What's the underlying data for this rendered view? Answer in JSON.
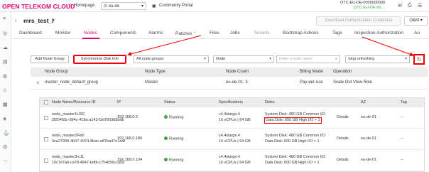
{
  "topbar": {
    "brand": "OPEN TELEKOM CLOUD",
    "homepage": "Homepage",
    "region": "eu-de",
    "community": "Community Portal",
    "account_id": "OTC-EU-DE-0000000000",
    "account_name": "OTC-EU-DE-00…"
  },
  "header": {
    "cluster_name": "mrs_test_l",
    "download_btn": "Download Authentication Credential",
    "om_btn": "O&M"
  },
  "tabs": [
    "Dashboard",
    "Monitor",
    "Nodes",
    "Components",
    "Alarms",
    "Patches",
    "Files",
    "Jobs",
    "Tenants",
    "Bootstrap Actions",
    "Tags",
    "Inspection Authorization",
    "Au"
  ],
  "toolbar": {
    "add_node_group": "Add Node Group",
    "sync_disk": "Synchronize Disk Info",
    "node_groups_filter": "All node groups",
    "node_filter": "Node",
    "search_placeholder": "Enter a node name",
    "refresh_mode": "Stop refreshing"
  },
  "group_table": {
    "headers": [
      "Node Group",
      "Node Type",
      "Node Count",
      "Billing Mode",
      "Operation"
    ],
    "row": {
      "name": "master_node_default_group",
      "type": "Master",
      "count": "eu-de-01: 3",
      "billing": "Pay-per-use",
      "scale_out": "Scale Out",
      "view_role": "View Role"
    }
  },
  "node_table": {
    "headers": [
      "Node Name/Resource ID",
      "IP",
      "Status",
      "Specifications",
      "Disks",
      "",
      "AZ",
      "Tag"
    ],
    "rows": [
      {
        "name": "node_master1tJSC",
        "rid": "2f20460c-994c-419a-a143-f3d790366bdb",
        "ip": "192.168.0.5",
        "status": "Running",
        "spec1": "c4.4xlarge.4",
        "spec2": "16 vCPUs | 64 GB",
        "disk1": "System Disk: 480 GB Common I/O",
        "disk2": "Data Disk: 600 GB High I/O × 1",
        "details": "Details",
        "az": "eu-de-01",
        "tag": "--"
      },
      {
        "name": "node_master2Fkbl",
        "rid": "4ca27990-3b07-4974-8bac-a87ba47e1a4f",
        "ip": "192.168.0.180",
        "status": "Running",
        "spec1": "c4.4xlarge.4",
        "spec2": "16 vCPUs | 64 GB",
        "disk1": "System Disk: 480 GB Common I/O",
        "disk2": "Data Disk: 600 GB High I/O × 1",
        "details": "Details",
        "az": "eu-de-01",
        "tag": "--"
      },
      {
        "name": "node_master3rcJL",
        "rid": "15c7e7a6-ca78-4847-bdfb-c754b56cca5d",
        "ip": "192.168.0.104",
        "status": "Running",
        "spec1": "c4.4xlarge.4",
        "spec2": "16 vCPUs | 64 GB",
        "disk1": "System Disk: 480 GB Common I/O",
        "disk2": "Data Disk: 600 GB High I/O × 1",
        "details": "Details",
        "az": "eu-de-01",
        "tag": "--"
      }
    ]
  },
  "colors": {
    "brand": "#e20074",
    "link": "#1a73c8",
    "running": "#3aaa35",
    "highlight": "#e00000"
  }
}
